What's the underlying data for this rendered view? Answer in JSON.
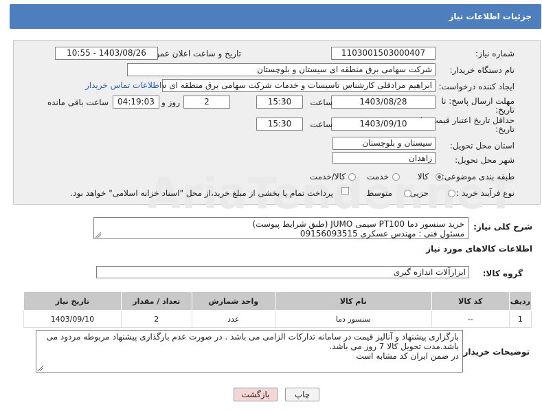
{
  "header": {
    "title": "جزئیات اطلاعات نیاز"
  },
  "form": {
    "need_number_label": "شماره نیاز:",
    "need_number": "1103001503000407",
    "announce_label": "تاریخ و ساعت اعلان عمومی:",
    "announce_value": "1403/08/26 - 10:55",
    "buyer_org_label": "نام دستگاه خریدار:",
    "buyer_org": "شرکت سهامی برق منطقه ای سیستان و بلوچستان",
    "requester_label": "ایجاد کننده درخواست:",
    "requester": "ابراهیم مرادقلی کارشناس تاسیسات و خدمات شرکت سهامی برق منطقه ای سیستان",
    "contact_link": "اطلاعات تماس خریدار",
    "deadline_label_1": "مهلت ارسال پاسخ: تا",
    "deadline_label_2": "تاریخ:",
    "deadline_date": "1403/08/28",
    "time_label": "ساعت",
    "deadline_time": "15:30",
    "days_value": "2",
    "days_label": "روز و",
    "remaining_time": "04:19:03",
    "remaining_label": "ساعت باقی مانده",
    "validity_label_1": "حداقل تاریخ اعتبار قیمت: تا",
    "validity_label_2": "تاریخ:",
    "validity_date": "1403/09/10",
    "validity_time": "15:30",
    "province_label": "استان محل تحویل:",
    "province": "سیستان و بلوچستان",
    "city_label": "شهر محل تحویل:",
    "city": "زاهدان",
    "category_label": "طبقه بندی موضوعی:",
    "category_options": [
      "کالا",
      "خدمت",
      "کالا/خدمت"
    ],
    "process_label": "نوع فرآیند خرید :",
    "process_options": [
      "جزیی",
      "متوسط"
    ],
    "payment_note": "پرداخت تمام یا بخشی از مبلغ خرید،از محل \"اسناد خزانه اسلامی\" خواهد بود."
  },
  "summary": {
    "label": "شرح کلی نیاز:",
    "lines": [
      "خرید سنسور دما PT100 سیمی JUMO (طبق شرایط پیوست)",
      "مسئول فنی : مهندس عسکری 09156093515"
    ]
  },
  "goods": {
    "section_title": "اطلاعات کالاهای مورد نیاز",
    "group_label": "گروه کالا:",
    "group_value": "ابزارآلات اندازه گیری",
    "columns": [
      "ردیف",
      "کد کالا",
      "نام کالا",
      "واحد شمارش",
      "تعداد / مقدار",
      "تاریخ نیاز"
    ],
    "rows": [
      [
        "1",
        "--",
        "سنسور دما",
        "عدد",
        "2",
        "1403/09/10"
      ]
    ]
  },
  "buyer_notes": {
    "label": "توضیحات خریدار:",
    "lines": [
      "بارگزاری پیشنهاد و آنالیز قیمت در سامانه تدارکات الزامی می باشد . در صورت عدم بارگذاری پیشنهاد مربوطه مردود می",
      "باشد.مدت تحویل کالا 7 روز می باشد.",
      "در ضمن ایران کد مشابه است"
    ]
  },
  "buttons": {
    "print": "چاپ",
    "back": "بازگشت"
  },
  "watermark": "AriaTender.neT",
  "colors": {
    "header": "#4d7fbf",
    "panel": "#efefef",
    "link": "#1f5fbf",
    "back_button": "#f5d5d5"
  }
}
